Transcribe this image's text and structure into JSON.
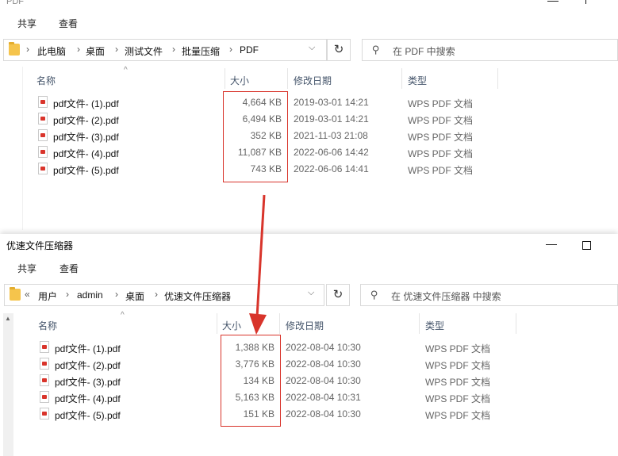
{
  "windows": [
    {
      "title": "PDF",
      "ribbon_tabs": [
        "共享",
        "查看"
      ],
      "breadcrumb": [
        "此电脑",
        "桌面",
        "测试文件",
        "批量压缩",
        "PDF"
      ],
      "search_placeholder": "在 PDF 中搜索",
      "columns": [
        "名称",
        "大小",
        "修改日期",
        "类型"
      ],
      "files": [
        {
          "name": "pdf文件- (1).pdf",
          "size": "4,664 KB",
          "date": "2019-03-01 14:21",
          "type": "WPS PDF 文档"
        },
        {
          "name": "pdf文件- (2).pdf",
          "size": "6,494 KB",
          "date": "2019-03-01 14:21",
          "type": "WPS PDF 文档"
        },
        {
          "name": "pdf文件- (3).pdf",
          "size": "352 KB",
          "date": "2021-11-03 21:08",
          "type": "WPS PDF 文档"
        },
        {
          "name": "pdf文件- (4).pdf",
          "size": "11,087 KB",
          "date": "2022-06-06 14:42",
          "type": "WPS PDF 文档"
        },
        {
          "name": "pdf文件- (5).pdf",
          "size": "743 KB",
          "date": "2022-06-06 14:41",
          "type": "WPS PDF 文档"
        }
      ]
    },
    {
      "title": "优速文件压缩器",
      "ribbon_tabs": [
        "共享",
        "查看"
      ],
      "breadcrumb_prefix": "«",
      "breadcrumb": [
        "用户",
        "admin",
        "桌面",
        "优速文件压缩器"
      ],
      "search_placeholder": "在 优速文件压缩器 中搜索",
      "columns": [
        "名称",
        "大小",
        "修改日期",
        "类型"
      ],
      "files": [
        {
          "name": "pdf文件- (1).pdf",
          "size": "1,388 KB",
          "date": "2022-08-04 10:30",
          "type": "WPS PDF 文档"
        },
        {
          "name": "pdf文件- (2).pdf",
          "size": "3,776 KB",
          "date": "2022-08-04 10:30",
          "type": "WPS PDF 文档"
        },
        {
          "name": "pdf文件- (3).pdf",
          "size": "134 KB",
          "date": "2022-08-04 10:30",
          "type": "WPS PDF 文档"
        },
        {
          "name": "pdf文件- (4).pdf",
          "size": "5,163 KB",
          "date": "2022-08-04 10:31",
          "type": "WPS PDF 文档"
        },
        {
          "name": "pdf文件- (5).pdf",
          "size": "151 KB",
          "date": "2022-08-04 10:30",
          "type": "WPS PDF 文档"
        }
      ]
    }
  ],
  "icons": {
    "chevron": "chevron-right-icon",
    "folder": "folder-icon",
    "refresh": "refresh-icon",
    "search": "search-icon",
    "file": "pdf-file-icon",
    "arrow": "red-down-arrow-icon"
  },
  "colors": {
    "highlight": "#d8342b",
    "folder": "#f5c44c"
  }
}
